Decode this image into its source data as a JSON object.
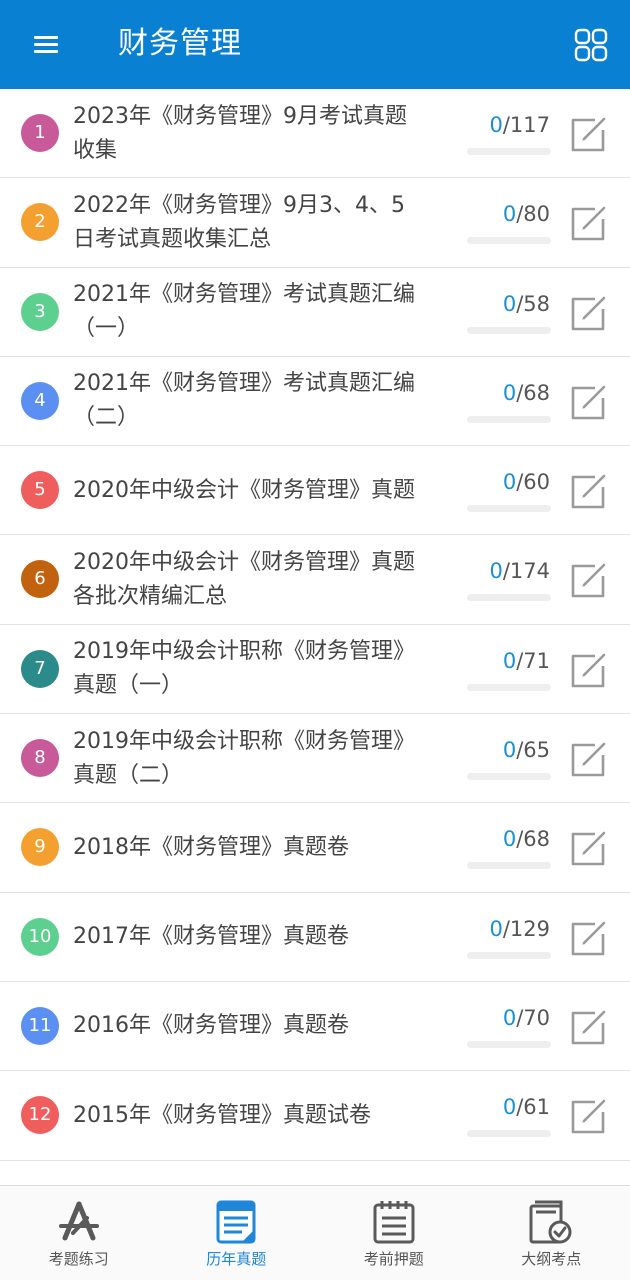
{
  "header": {
    "title": "财务管理",
    "menu_icon": "hamburger-menu-icon",
    "grid_icon": "grid-view-icon",
    "background": "#0a80d2"
  },
  "list": {
    "items": [
      {
        "index": "1",
        "title_lines": [
          "2023年《财务管理》9月考试真题",
          "收集"
        ],
        "done": "0",
        "total": "/117",
        "progress": 0,
        "badge_color": "#c95a9a"
      },
      {
        "index": "2",
        "title_lines": [
          "2022年《财务管理》9月3、4、5",
          "日考试真题收集汇总"
        ],
        "done": "0",
        "total": "/80",
        "progress": 0,
        "badge_color": "#f4a030"
      },
      {
        "index": "3",
        "title_lines": [
          "2021年《财务管理》考试真题汇编",
          "（一）"
        ],
        "done": "0",
        "total": "/58",
        "progress": 0,
        "badge_color": "#5dcf8e"
      },
      {
        "index": "4",
        "title_lines": [
          "2021年《财务管理》考试真题汇编",
          "（二）"
        ],
        "done": "0",
        "total": "/68",
        "progress": 0,
        "badge_color": "#5b8ff2"
      },
      {
        "index": "5",
        "title_lines": [
          "2020年中级会计《财务管理》真题"
        ],
        "done": "0",
        "total": "/60",
        "progress": 0,
        "badge_color": "#ef5d5d"
      },
      {
        "index": "6",
        "title_lines": [
          "2020年中级会计《财务管理》真题",
          "各批次精编汇总"
        ],
        "done": "0",
        "total": "/174",
        "progress": 0,
        "badge_color": "#c2620e"
      },
      {
        "index": "7",
        "title_lines": [
          "2019年中级会计职称《财务管理》",
          "真题（一）"
        ],
        "done": "0",
        "total": "/71",
        "progress": 0,
        "badge_color": "#2b8a8a"
      },
      {
        "index": "8",
        "title_lines": [
          "2019年中级会计职称《财务管理》",
          "真题（二）"
        ],
        "done": "0",
        "total": "/65",
        "progress": 0,
        "badge_color": "#c95a9a"
      },
      {
        "index": "9",
        "title_lines": [
          "2018年《财务管理》真题卷"
        ],
        "done": "0",
        "total": "/68",
        "progress": 0,
        "badge_color": "#f4a030"
      },
      {
        "index": "10",
        "title_lines": [
          "2017年《财务管理》真题卷"
        ],
        "done": "0",
        "total": "/129",
        "progress": 0,
        "badge_color": "#5dcf8e"
      },
      {
        "index": "11",
        "title_lines": [
          "2016年《财务管理》真题卷"
        ],
        "done": "0",
        "total": "/70",
        "progress": 0,
        "badge_color": "#5b8ff2"
      },
      {
        "index": "12",
        "title_lines": [
          "2015年《财务管理》真题试卷"
        ],
        "done": "0",
        "total": "/61",
        "progress": 0,
        "badge_color": "#ef5d5d"
      }
    ],
    "edit_icon": "edit-note-icon"
  },
  "tabbar": {
    "tabs": [
      {
        "label": "考题练习",
        "icon": "practice-compass-icon",
        "active": false
      },
      {
        "label": "历年真题",
        "icon": "past-papers-icon",
        "active": true
      },
      {
        "label": "考前押题",
        "icon": "exam-notepad-icon",
        "active": false
      },
      {
        "label": "大纲考点",
        "icon": "syllabus-check-icon",
        "active": false
      }
    ],
    "active_color": "#1f86d9"
  }
}
